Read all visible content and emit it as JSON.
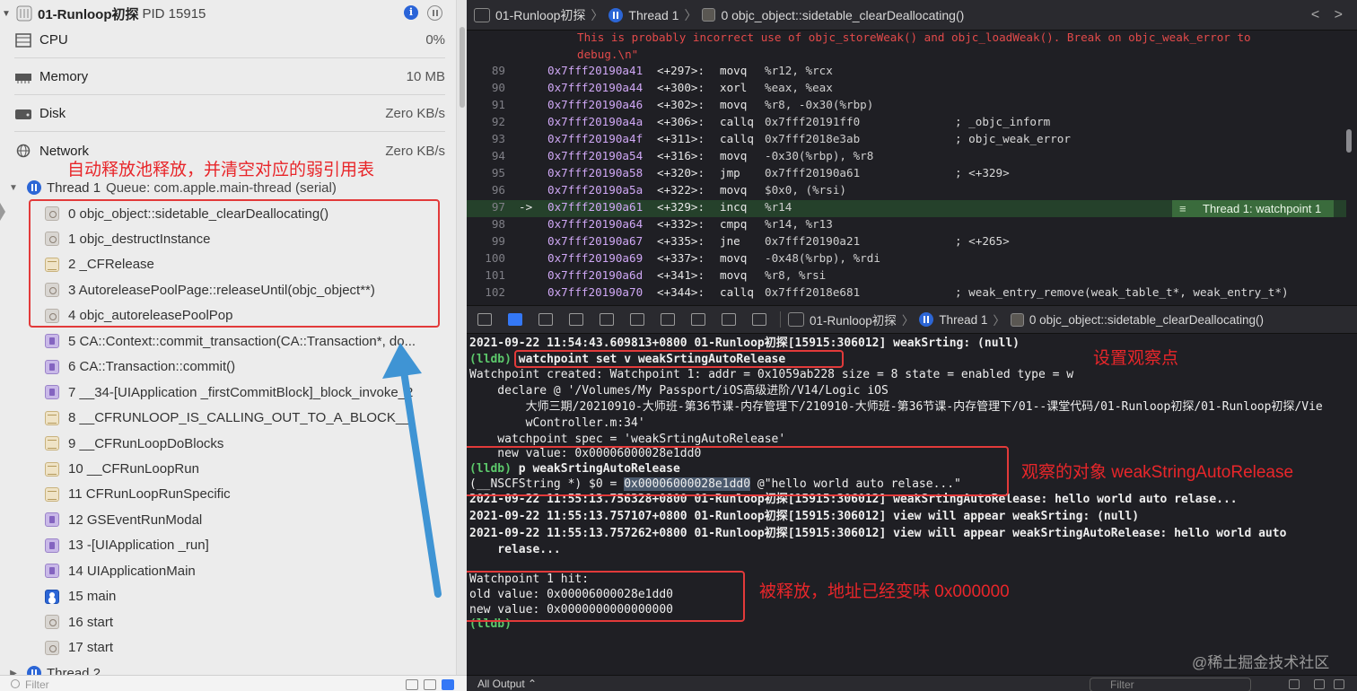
{
  "process": {
    "name": "01-Runloop初探",
    "pid_label": "PID 15915"
  },
  "gauges": [
    {
      "name": "CPU",
      "value": "0%"
    },
    {
      "name": "Memory",
      "value": "10 MB"
    },
    {
      "name": "Disk",
      "value": "Zero KB/s"
    },
    {
      "name": "Network",
      "value": "Zero KB/s"
    }
  ],
  "thread1": {
    "label": "Thread 1",
    "queue": "Queue: com.apple.main-thread (serial)"
  },
  "frames": [
    {
      "text": "0 objc_object::sidetable_clearDeallocating()",
      "icon": "gear-icon"
    },
    {
      "text": "1 objc_destructInstance",
      "icon": "gear-icon"
    },
    {
      "text": "2 _CFRelease",
      "icon": "table-icon"
    },
    {
      "text": "3 AutoreleasePoolPage::releaseUntil(objc_object**)",
      "icon": "gear-icon"
    },
    {
      "text": "4 objc_autoreleasePoolPop",
      "icon": "gear-icon"
    },
    {
      "text": "5 CA::Context::commit_transaction(CA::Transaction*, do...",
      "icon": "purple-icon"
    },
    {
      "text": "6 CA::Transaction::commit()",
      "icon": "purple-icon"
    },
    {
      "text": "7 __34-[UIApplication _firstCommitBlock]_block_invoke_2",
      "icon": "purple-icon"
    },
    {
      "text": "8 __CFRUNLOOP_IS_CALLING_OUT_TO_A_BLOCK__",
      "icon": "table-icon"
    },
    {
      "text": "9 __CFRunLoopDoBlocks",
      "icon": "table-icon"
    },
    {
      "text": "10 __CFRunLoopRun",
      "icon": "table-icon"
    },
    {
      "text": "11 CFRunLoopRunSpecific",
      "icon": "table-icon"
    },
    {
      "text": "12 GSEventRunModal",
      "icon": "purple-icon"
    },
    {
      "text": "13 -[UIApplication _run]",
      "icon": "purple-icon"
    },
    {
      "text": "14 UIApplicationMain",
      "icon": "purple-icon"
    },
    {
      "text": "15 main",
      "icon": "person-icon"
    },
    {
      "text": "16 start",
      "icon": "gear-icon"
    },
    {
      "text": "17 start",
      "icon": "gear-icon"
    }
  ],
  "thread2": {
    "label": "Thread 2"
  },
  "left_annotation": "自动释放池释放，并清空对应的弱引用表",
  "left_filter_placeholder": "Filter",
  "jumpbar": {
    "project": "01-Runloop初探",
    "thread": "Thread 1",
    "frame": "0 objc_object::sidetable_clearDeallocating()",
    "nav": "< >"
  },
  "code": {
    "error_line1": "This is probably incorrect use of objc_storeWeak() and objc_loadWeak(). Break on objc_weak_error to",
    "error_line2": "debug.\\n\"",
    "lines": [
      {
        "ln": "89",
        "arrow": "",
        "addr": "0x7fff20190a41",
        "off": "<+297>:",
        "instr": "movq",
        "ops": "%r12, %rcx",
        "comment": ""
      },
      {
        "ln": "90",
        "arrow": "",
        "addr": "0x7fff20190a44",
        "off": "<+300>:",
        "instr": "xorl",
        "ops": "%eax, %eax",
        "comment": ""
      },
      {
        "ln": "91",
        "arrow": "",
        "addr": "0x7fff20190a46",
        "off": "<+302>:",
        "instr": "movq",
        "ops": "%r8, -0x30(%rbp)",
        "comment": ""
      },
      {
        "ln": "92",
        "arrow": "",
        "addr": "0x7fff20190a4a",
        "off": "<+306>:",
        "instr": "callq",
        "ops": "0x7fff20191ff0",
        "comment": "; _objc_inform"
      },
      {
        "ln": "93",
        "arrow": "",
        "addr": "0x7fff20190a4f",
        "off": "<+311>:",
        "instr": "callq",
        "ops": "0x7fff2018e3ab",
        "comment": "; objc_weak_error"
      },
      {
        "ln": "94",
        "arrow": "",
        "addr": "0x7fff20190a54",
        "off": "<+316>:",
        "instr": "movq",
        "ops": "-0x30(%rbp), %r8",
        "comment": ""
      },
      {
        "ln": "95",
        "arrow": "",
        "addr": "0x7fff20190a58",
        "off": "<+320>:",
        "instr": "jmp",
        "ops": "0x7fff20190a61",
        "comment": "; <+329>"
      },
      {
        "ln": "96",
        "arrow": "",
        "addr": "0x7fff20190a5a",
        "off": "<+322>:",
        "instr": "movq",
        "ops": "$0x0, (%rsi)",
        "comment": ""
      },
      {
        "ln": "97",
        "arrow": "->",
        "addr": "0x7fff20190a61",
        "off": "<+329>:",
        "instr": "incq",
        "ops": "%r14",
        "comment": ""
      },
      {
        "ln": "98",
        "arrow": "",
        "addr": "0x7fff20190a64",
        "off": "<+332>:",
        "instr": "cmpq",
        "ops": "%r14, %r13",
        "comment": ""
      },
      {
        "ln": "99",
        "arrow": "",
        "addr": "0x7fff20190a67",
        "off": "<+335>:",
        "instr": "jne",
        "ops": "0x7fff20190a21",
        "comment": "; <+265>"
      },
      {
        "ln": "100",
        "arrow": "",
        "addr": "0x7fff20190a69",
        "off": "<+337>:",
        "instr": "movq",
        "ops": "-0x48(%rbp), %rdi",
        "comment": ""
      },
      {
        "ln": "101",
        "arrow": "",
        "addr": "0x7fff20190a6d",
        "off": "<+341>:",
        "instr": "movq",
        "ops": "%r8, %rsi",
        "comment": ""
      },
      {
        "ln": "102",
        "arrow": "",
        "addr": "0x7fff20190a70",
        "off": "<+344>:",
        "instr": "callq",
        "ops": "0x7fff2018e681",
        "comment": "; weak_entry_remove(weak_table_t*, weak_entry_t*)"
      }
    ],
    "watchpoint_badge": "Thread 1: watchpoint 1"
  },
  "debugbar": {
    "project": "01-Runloop初探",
    "thread": "Thread 1",
    "frame": "0 objc_object::sidetable_clearDeallocating()"
  },
  "console": {
    "l1": "2021-09-22 11:54:43.609813+0800 01-Runloop初探[15915:306012] weakSrting: (null)",
    "l2_prompt": "(lldb)",
    "l2_cmd": " watchpoint set v weakSrtingAutoRelease",
    "l3": "Watchpoint created: Watchpoint 1: addr = 0x1059ab228 size = 8 state = enabled type = w",
    "l4": "    declare @ '/Volumes/My Passport/iOS高级进阶/V14/Logic iOS",
    "l5": "        大师三期/20210910-大师班-第36节课-内存管理下/210910-大师班-第36节课-内存管理下/01--课堂代码/01-Runloop初探/01-Runloop初探/Vie",
    "l6": "        wController.m:34'",
    "l7": "    watchpoint spec = 'weakSrtingAutoRelease'",
    "l8": "    new value: 0x00006000028e1dd0",
    "l9_prompt": "(lldb)",
    "l9_cmd": " p weakSrtingAutoRelease",
    "l10_a": "(__NSCFString *) $0 = ",
    "l10_sel": "0x00006000028e1dd0",
    "l10_b": " @\"hello world auto relase...\"",
    "l11": "2021-09-22 11:55:13.756328+0800 01-Runloop初探[15915:306012] weakSrtingAutoRelease: hello world auto relase...",
    "l12": "2021-09-22 11:55:13.757107+0800 01-Runloop初探[15915:306012] view will appear weakSrting: (null)",
    "l13": "2021-09-22 11:55:13.757262+0800 01-Runloop初探[15915:306012] view will appear weakSrtingAutoRelease: hello world auto",
    "l14": "    relase...",
    "l15": "Watchpoint 1 hit:",
    "l16": "old value: 0x00006000028e1dd0",
    "l17": "new value: 0x0000000000000000",
    "l18": "(lldb)"
  },
  "annotations": {
    "set_watchpoint": "设置观察点",
    "observed_object": "观察的对象 weakStringAutoRelease",
    "released": "被释放，地址已经变味 0x000000"
  },
  "console_footer": {
    "output": "All Output ⌃",
    "filter_placeholder": "Filter"
  },
  "watermark": "@稀土掘金技术社区",
  "colors": {
    "annotation_red": "#e8262a",
    "arrow_blue": "#3f94d4",
    "highlight_green": "#25412b"
  }
}
